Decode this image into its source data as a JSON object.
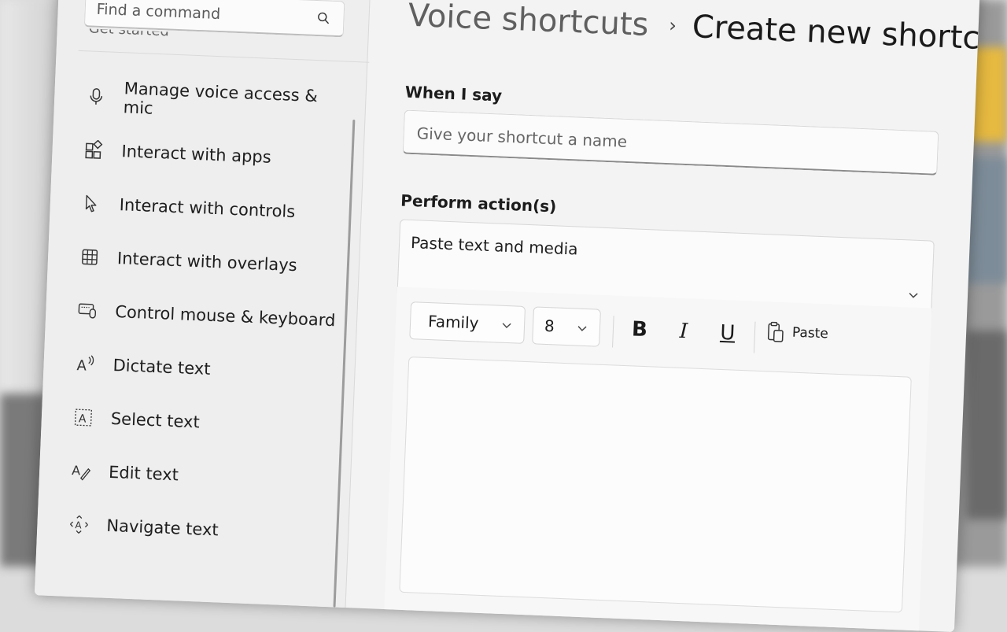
{
  "sidebar": {
    "search": {
      "placeholder": "Find a command"
    },
    "cut_off_item": "Get started",
    "items": [
      {
        "label": "Manage voice access & mic",
        "icon": "microphone-icon"
      },
      {
        "label": "Interact with apps",
        "icon": "apps-icon"
      },
      {
        "label": "Interact with controls",
        "icon": "cursor-icon"
      },
      {
        "label": "Interact with overlays",
        "icon": "grid-icon"
      },
      {
        "label": "Control mouse & keyboard",
        "icon": "keyboard-mouse-icon"
      },
      {
        "label": "Dictate text",
        "icon": "dictate-icon"
      },
      {
        "label": "Select text",
        "icon": "select-text-icon"
      },
      {
        "label": "Edit text",
        "icon": "edit-text-icon"
      },
      {
        "label": "Navigate text",
        "icon": "navigate-text-icon"
      }
    ]
  },
  "breadcrumb": {
    "parent": "Voice shortcuts",
    "separator": "›",
    "current": "Create new shortcut"
  },
  "form": {
    "when_label": "When I say",
    "name_placeholder": "Give your shortcut a name",
    "perform_label": "Perform action(s)",
    "action_value": "Paste text and media"
  },
  "editor": {
    "font_family": "Family",
    "font_size": "8",
    "bold": "B",
    "italic": "I",
    "underline": "U",
    "paste_label": "Paste"
  }
}
